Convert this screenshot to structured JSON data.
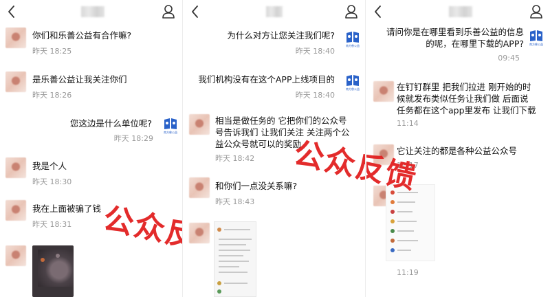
{
  "panel1": {
    "messages": [
      {
        "text": "你们和乐善公益有合作嘛?",
        "time": "昨天 18:25"
      },
      {
        "text": "是乐善公益让我关注你们",
        "time": "昨天 18:26"
      },
      {
        "text": "您这边是什么单位呢?",
        "time": "昨天 18:29"
      },
      {
        "text": "我是个人",
        "time": "昨天 18:30"
      },
      {
        "text": "我在上面被骗了钱",
        "time": "昨天 18:31"
      }
    ]
  },
  "panel2": {
    "messages": [
      {
        "text": "为什么对方让您关注我们呢?",
        "time": "昨天 18:40"
      },
      {
        "text": "我们机构没有在这个APP上线项目的",
        "time": "昨天 18:40"
      },
      {
        "line1": "相当是做任务的  它把你们的公众号",
        "line2": "号告诉我们 让我们关注  关注两个公",
        "line3": "益公众号就可以的奖励",
        "time": "昨天 18:42"
      },
      {
        "text": "和你们一点没关系嘛?",
        "time": "昨天 18:43"
      }
    ]
  },
  "panel3": {
    "messages": [
      {
        "line1": "请问你是在哪里看到乐善公益的信息",
        "line2": "的呢，在哪里下载的APP?",
        "time": "09:45"
      },
      {
        "line1": "在钉钉群里  把我们拉进 刚开始的时",
        "line2": "候就发布类似任务让我们做  后面说",
        "line3": "任务都在这个app里发布 让我们下载",
        "time": "11:14"
      },
      {
        "text": "它让关注的都是各种公益公众号",
        "time": "11:17"
      },
      {
        "time": "11:19"
      }
    ]
  },
  "org_avatar_caption": "南方慈公益",
  "stamp_text": "公众反馈",
  "icons": {
    "back": "chevron-left-icon",
    "profile": "person-icon"
  },
  "colors": {
    "stamp": "#e11a1a",
    "org_blue": "#2a62c9"
  }
}
